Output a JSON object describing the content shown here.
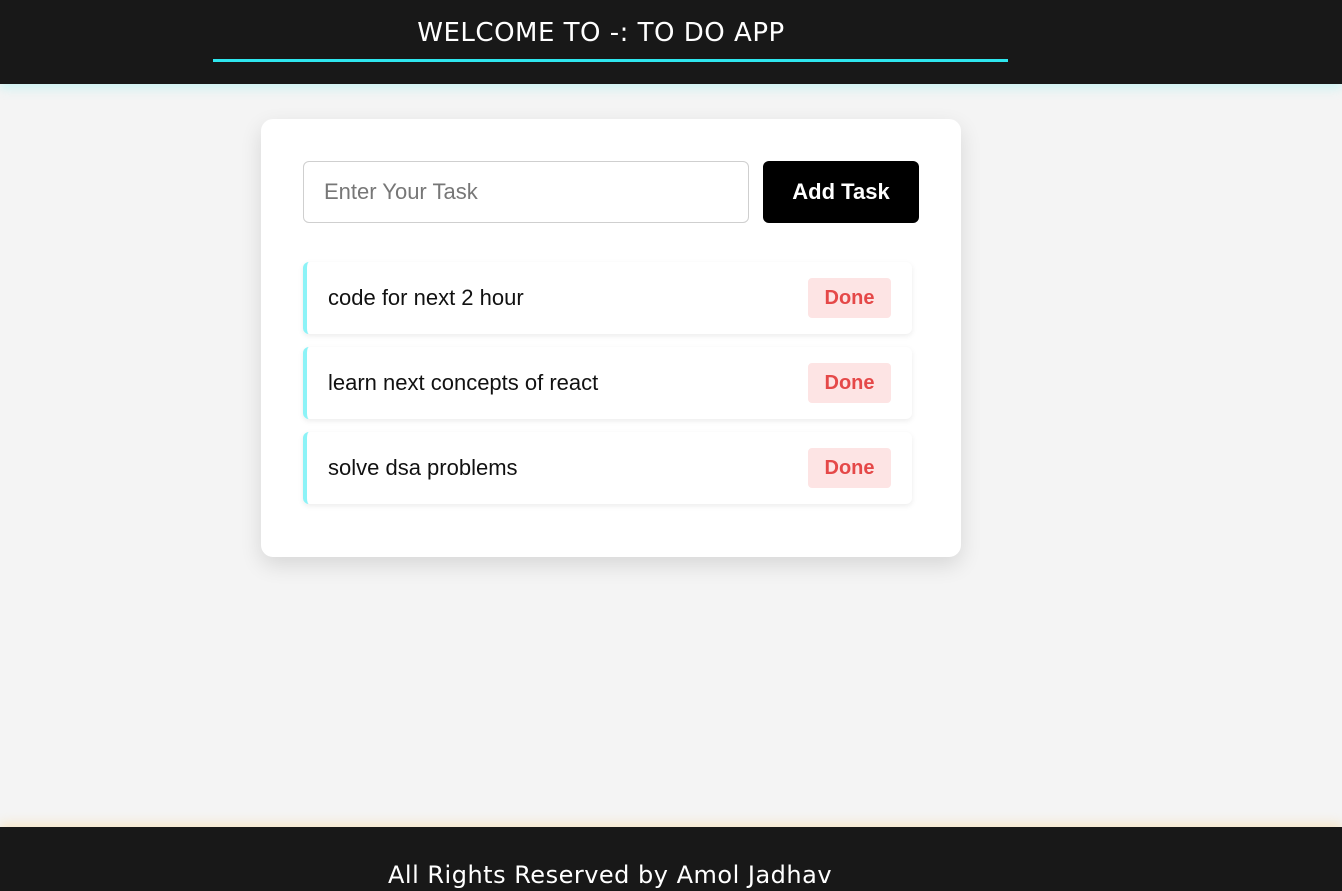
{
  "header": {
    "title": "WELCOME TO -: TO DO APP",
    "underline_color": "#2ee6ee"
  },
  "task_form": {
    "input_placeholder": "Enter Your Task",
    "input_value": "",
    "add_button_label": "Add Task"
  },
  "tasks": [
    {
      "text": "code for next 2 hour",
      "done_label": "Done"
    },
    {
      "text": "learn next concepts of react",
      "done_label": "Done"
    },
    {
      "text": "solve dsa problems",
      "done_label": "Done"
    }
  ],
  "footer": {
    "text": "All Rights Reserved by Amol Jadhav"
  },
  "colors": {
    "header_bg": "#181818",
    "page_bg": "#f4f4f4",
    "accent": "#8cf3f7",
    "done_bg": "#fde4e4",
    "done_text": "#e54848"
  }
}
